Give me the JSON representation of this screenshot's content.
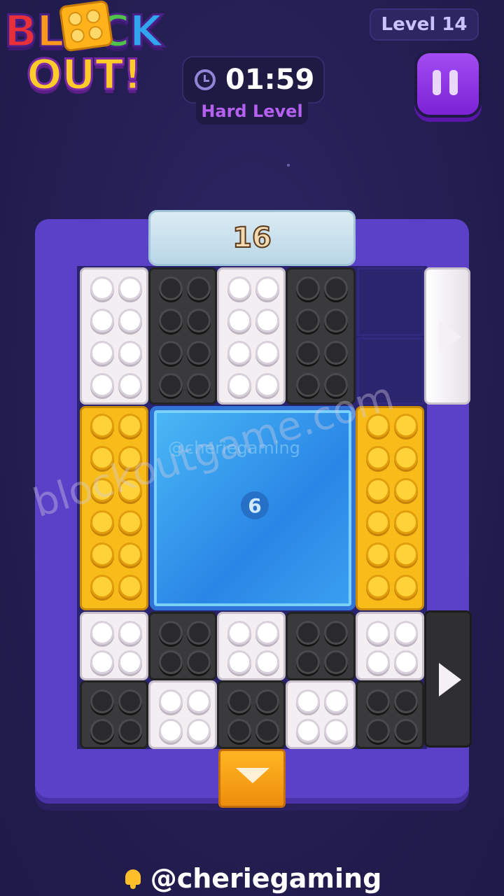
{
  "logo": {
    "line1": "BLOCK",
    "line2": "OUT!",
    "colors": [
      "#e8303a",
      "#ff9a1f",
      "#f6c322",
      "#4ec24a",
      "#31a6ef"
    ]
  },
  "header": {
    "level_label": "Level 14",
    "timer": "01:59",
    "difficulty": "Hard Level"
  },
  "board": {
    "top_counter": "16",
    "blue_block_count": "6",
    "watermark_inner": "@cheriegaming",
    "watermark": "blockoutgame.com",
    "block_colors": {
      "white": "#f2eef2",
      "black": "#3a3a3c",
      "yellow": "#f7bb1a",
      "blue": "#3aa0f0"
    },
    "exits": [
      {
        "color": "white",
        "side": "right",
        "arrow": "right"
      },
      {
        "color": "black",
        "side": "right",
        "arrow": "right"
      },
      {
        "color": "yellow",
        "side": "bottom",
        "arrow": "down"
      }
    ]
  },
  "footer": {
    "handle": "@cheriegaming",
    "icon": "bell-icon"
  }
}
